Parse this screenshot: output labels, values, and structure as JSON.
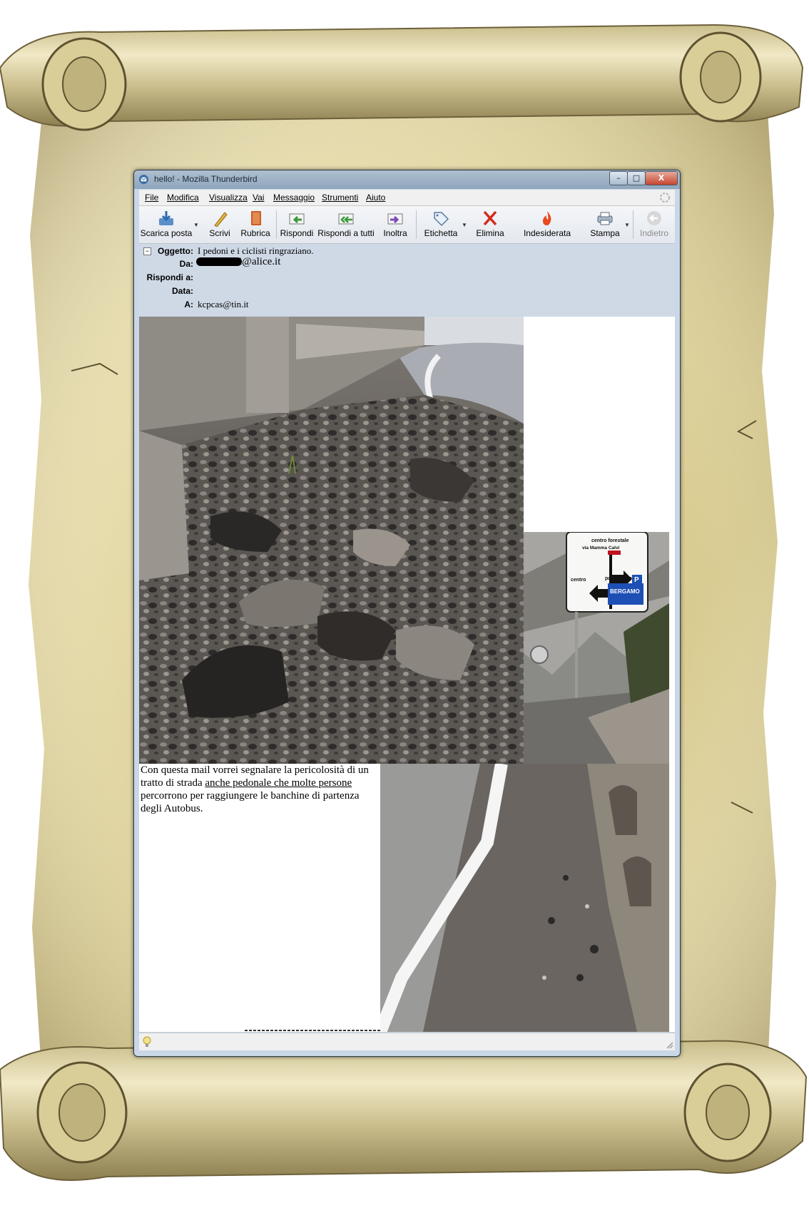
{
  "window": {
    "title": "hello! - Mozilla Thunderbird",
    "controls": {
      "minimize": "–",
      "maximize": "□",
      "close": "X"
    }
  },
  "menu": [
    "File",
    "Modifica",
    "Visualizza",
    "Vai",
    "Messaggio",
    "Strumenti",
    "Aiuto"
  ],
  "toolbar": {
    "get_mail": "Scarica posta",
    "write": "Scrivi",
    "address_book": "Rubrica",
    "reply": "Rispondi",
    "reply_all": "Rispondi a tutti",
    "forward": "Inoltra",
    "tag": "Etichetta",
    "delete": "Elimina",
    "junk": "Indesiderata",
    "print": "Stampa",
    "back": "Indietro"
  },
  "headers": {
    "subject_label": "Oggetto:",
    "subject": "I pedoni e i ciclisti ringraziano.",
    "from_label": "Da:",
    "from": "i@alice.it",
    "reply_to_label": "Rispondi a:",
    "reply_to": "",
    "date_label": "Data:",
    "date": "",
    "to_label": "A:",
    "to": "kcpcas@tin.it"
  },
  "body": {
    "text_before": "Con questa mail vorrei segnalare la pericolosità di un tratto di strada ",
    "text_underlined": "anche pedonale che molte persone",
    "text_after": " percorrono per raggiungere  le banchine di partenza degli Autobus."
  },
  "sign": {
    "line1": "centro forestale",
    "line2": "via Mamma Calvi",
    "left": "centro",
    "right": "parcheggio",
    "p": "P",
    "city": "BERGAMO"
  },
  "colors": {
    "parchment": "#e3d9a8",
    "window_frame": "#2d3a4a",
    "header_bg": "#cfd9e6",
    "close_button": "#c5462f"
  }
}
